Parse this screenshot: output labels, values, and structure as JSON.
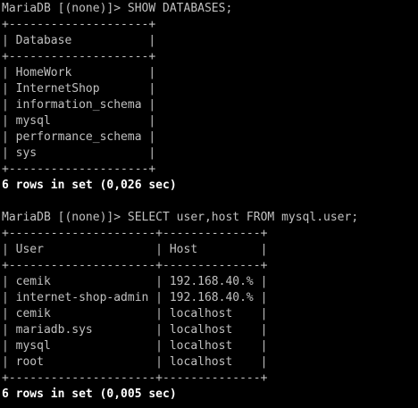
{
  "terminal": {
    "lines": [
      {
        "text": "MariaDB [(none)]> SHOW DATABASES;",
        "bold": false
      },
      {
        "text": "+--------------------+",
        "bold": false
      },
      {
        "text": "| Database           |",
        "bold": false
      },
      {
        "text": "+--------------------+",
        "bold": false
      },
      {
        "text": "| HomeWork           |",
        "bold": false
      },
      {
        "text": "| InternetShop       |",
        "bold": false
      },
      {
        "text": "| information_schema |",
        "bold": false
      },
      {
        "text": "| mysql              |",
        "bold": false
      },
      {
        "text": "| performance_schema |",
        "bold": false
      },
      {
        "text": "| sys                |",
        "bold": false
      },
      {
        "text": "+--------------------+",
        "bold": false
      },
      {
        "text": "6 rows in set (0,026 sec)",
        "bold": true
      },
      {
        "text": "",
        "bold": false
      },
      {
        "text": "MariaDB [(none)]> SELECT user,host FROM mysql.user;",
        "bold": false
      },
      {
        "text": "+---------------------+--------------+",
        "bold": false
      },
      {
        "text": "| User                | Host         |",
        "bold": false
      },
      {
        "text": "+---------------------+--------------+",
        "bold": false
      },
      {
        "text": "| cemik               | 192.168.40.% |",
        "bold": false
      },
      {
        "text": "| internet-shop-admin | 192.168.40.% |",
        "bold": false
      },
      {
        "text": "| cemik               | localhost    |",
        "bold": false
      },
      {
        "text": "| mariadb.sys         | localhost    |",
        "bold": false
      },
      {
        "text": "| mysql               | localhost    |",
        "bold": false
      },
      {
        "text": "| root                | localhost    |",
        "bold": false
      },
      {
        "text": "+---------------------+--------------+",
        "bold": false
      },
      {
        "text": "6 rows in set (0,005 sec)",
        "bold": true
      }
    ]
  },
  "colors": {
    "background": "#000000",
    "text": "#c0c0c0",
    "bold_text": "#ffffff"
  }
}
